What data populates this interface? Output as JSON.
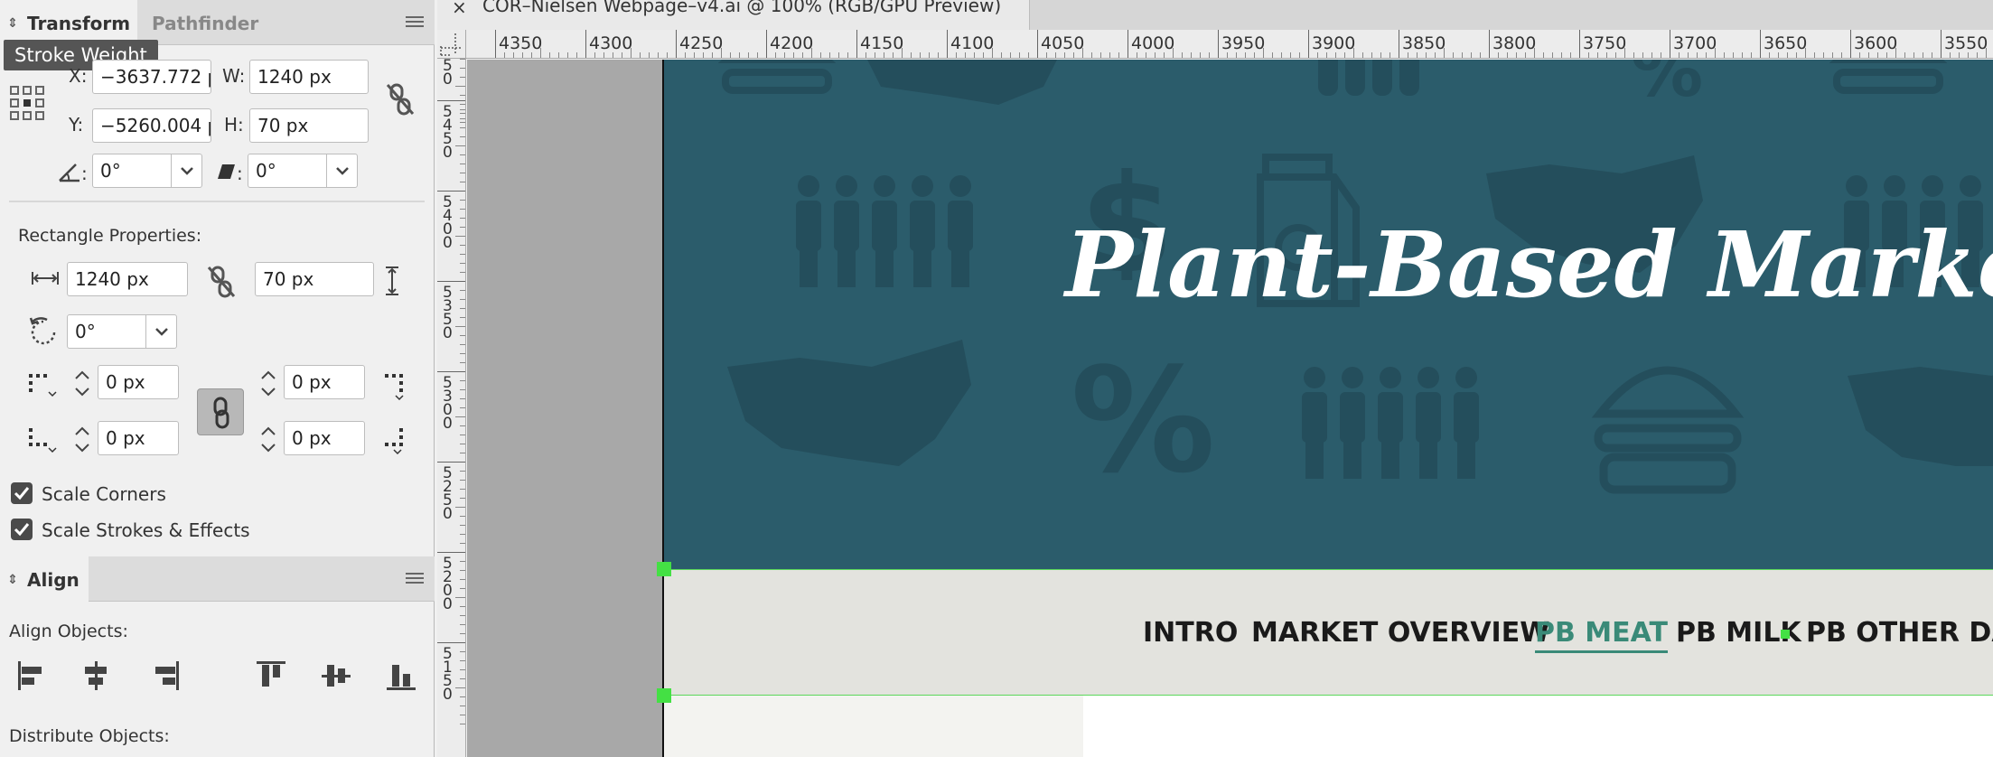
{
  "panel": {
    "tabs": [
      "Transform",
      "Pathfinder"
    ],
    "tooltip": "Stroke Weight",
    "x_label": "X:",
    "x_value": "−3637.772 p",
    "y_label": "Y:",
    "y_value": "−5260.004 p",
    "w_label": "W:",
    "w_value": "1240 px",
    "h_label": "H:",
    "h_value": "70 px",
    "angle_label": ":",
    "angle_value": "0°",
    "shear_label": ":",
    "shear_value": "0°",
    "rect_props_label": "Rectangle Properties:",
    "rect_w_value": "1240 px",
    "rect_h_value": "70 px",
    "rect_rotate_value": "0°",
    "corner_tl_value": "0 px",
    "corner_tr_value": "0 px",
    "corner_bl_value": "0 px",
    "corner_br_value": "0 px",
    "scale_corners_label": "Scale Corners",
    "scale_strokes_label": "Scale Strokes & Effects",
    "align_tab": "Align",
    "align_objects_label": "Align Objects:",
    "distribute_objects_label": "Distribute Objects:"
  },
  "document": {
    "tab_title": "COR–Nielsen Webpage–v4.ai @ 100% (RGB/GPU Preview)",
    "close_glyph": "×",
    "hruler_labels": [
      "4350",
      "4300",
      "4250",
      "4200",
      "4150",
      "4100",
      "4050",
      "4000",
      "3950",
      "3900",
      "3850",
      "3800",
      "3750",
      "3700",
      "3650",
      "3600",
      "3550"
    ],
    "vruler_labels": [
      [
        "5",
        "5",
        "0"
      ],
      [
        "5",
        "4",
        "5",
        "0"
      ],
      [
        "5",
        "4",
        "0",
        "0"
      ],
      [
        "5",
        "3",
        "5",
        "0"
      ],
      [
        "5",
        "3",
        "0",
        "0"
      ],
      [
        "5",
        "2",
        "5",
        "0"
      ],
      [
        "5",
        "2",
        "0",
        "0"
      ],
      [
        "5",
        "1",
        "5",
        "0"
      ]
    ],
    "hero_title": "Plant-Based Market",
    "nav": [
      "INTRO",
      "MARKET OVERVIEW",
      "PB MEAT",
      "PB MILK",
      "PB OTHER DAIR"
    ],
    "nav_active_index": 2
  },
  "colors": {
    "hero_bg": "#2b5c6b",
    "hero_icon": "#244e5c",
    "nav_bg": "#e3e3de",
    "nav_active": "#3a8a78",
    "selection": "#44e044",
    "pasteboard": "#a8a8a8"
  }
}
